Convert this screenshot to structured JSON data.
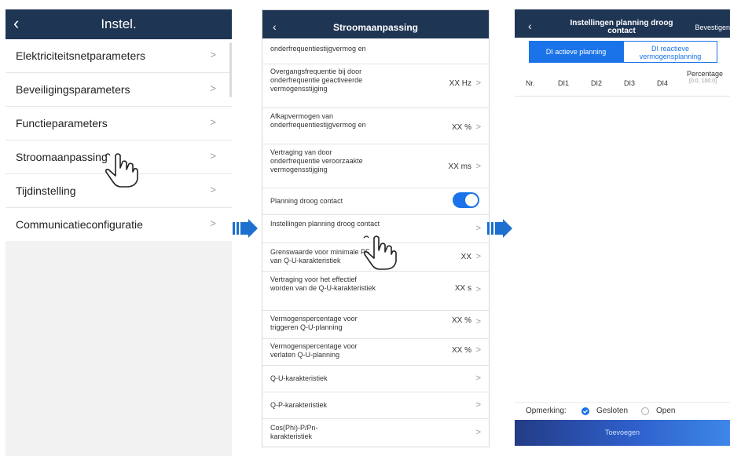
{
  "panel1": {
    "title": "Instel.",
    "items": [
      {
        "label": "Elektriciteitsnetparameters"
      },
      {
        "label": "Beveiligingsparameters"
      },
      {
        "label": "Functieparameters"
      },
      {
        "label": "Stroomaanpassing"
      },
      {
        "label": "Tijdinstelling"
      },
      {
        "label": "Communicatieconfiguratie"
      }
    ]
  },
  "panel2": {
    "title": "Stroomaanpassing",
    "rows": [
      {
        "label": "onderfrequentiestijgvermog en",
        "value": ""
      },
      {
        "label": "Overgangsfrequentie bij door onderfrequentie geactiveerde vermogensstijging",
        "value": "XX Hz"
      },
      {
        "label": "Afkapvermogen van onderfrequentiestijgvermog en",
        "value": "XX %"
      },
      {
        "label": "Vertraging van door onderfrequentie veroorzaakte vermogensstijging",
        "value": "XX ms"
      },
      {
        "label": "Planning droog contact",
        "value": ""
      },
      {
        "label": "Instellingen planning droog contact",
        "value": ""
      },
      {
        "label": "Grenswaarde voor minimale PF van Q-U-karakteristiek",
        "value": "XX"
      },
      {
        "label": "Vertraging voor het effectief worden van de Q-U-karakteristiek",
        "value": "XX s"
      },
      {
        "label": "Vermogenspercentage voor triggeren Q-U-planning",
        "value": "XX %"
      },
      {
        "label": "Vermogenspercentage voor verlaten Q-U-planning",
        "value": "XX %"
      },
      {
        "label": "Q-U-karakteristiek",
        "value": ""
      },
      {
        "label": "Q-P-karakteristiek",
        "value": ""
      },
      {
        "label": "Cos(Phi)-P/Pn-karakteristiek",
        "value": ""
      }
    ]
  },
  "panel3": {
    "title": "Instellingen planning droog contact",
    "confirm": "Bevestigen",
    "tab_active_line1": "DI actieve planning",
    "tab_reactive_line1": "DI reactieve",
    "tab_reactive_line2": "vermogensplanning",
    "columns": [
      "Nr.",
      "DI1",
      "DI2",
      "DI3",
      "DI4"
    ],
    "percentage_label": "Percentage",
    "percentage_range": "[0.0, 100.0]",
    "remark_label": "Opmerking:",
    "option_closed": "Gesloten",
    "option_open": "Open",
    "add_label": "Toevoegen"
  },
  "colors": {
    "header": "#1f3554",
    "accent": "#1a73e8",
    "arrow": "#1d6fd0"
  }
}
